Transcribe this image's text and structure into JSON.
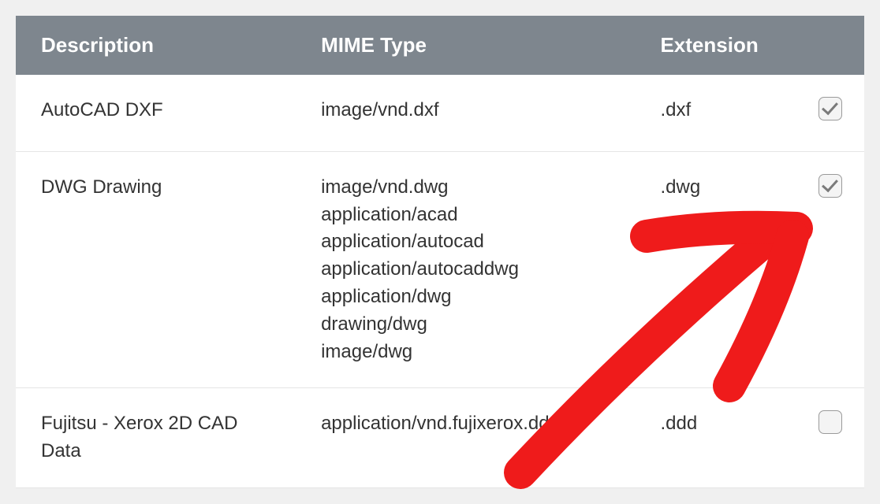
{
  "headers": {
    "description": "Description",
    "mime": "MIME Type",
    "extension": "Extension"
  },
  "rows": [
    {
      "description": "AutoCAD DXF",
      "mimes": [
        "image/vnd.dxf"
      ],
      "extension": ".dxf",
      "checked": true
    },
    {
      "description": "DWG Drawing",
      "mimes": [
        "image/vnd.dwg",
        "application/acad",
        "application/autocad",
        "application/autocaddwg",
        "application/dwg",
        "drawing/dwg",
        "image/dwg"
      ],
      "extension": ".dwg",
      "checked": true
    },
    {
      "description": "Fujitsu - Xerox 2D CAD Data",
      "mimes": [
        "application/vnd.fujixerox.ddd"
      ],
      "extension": ".ddd",
      "checked": false
    }
  ],
  "annotation_color": "#ef1b1b"
}
